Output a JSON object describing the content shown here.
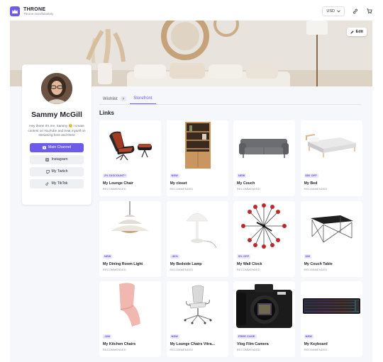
{
  "header": {
    "brand": "THRONE",
    "tagline": "Throne invisifulantely",
    "currency": "USD"
  },
  "banner": {
    "edit_label": "Edit"
  },
  "profile": {
    "name": "Sammy McGill",
    "bio": "Hey there! It's me, Sammy 😊 I create content on YouTube and treat myself on streaming here and there",
    "links": [
      {
        "label": "Main Channel",
        "icon": "play-icon"
      },
      {
        "label": "Instagram",
        "icon": "instagram-icon"
      },
      {
        "label": "My Twitch",
        "icon": "twitch-icon"
      },
      {
        "label": "My TikTok",
        "icon": "tiktok-icon"
      }
    ]
  },
  "tabs": [
    {
      "label": "Wishlist",
      "count": "7"
    },
    {
      "label": "Storefront"
    }
  ],
  "section_title": "Links",
  "products": [
    {
      "title": "My Lounge Chair",
      "badge": "2% DISCOUNT*",
      "sub": "RECOMMENDED"
    },
    {
      "title": "My closet",
      "badge": "NEW",
      "sub": "RECOMMENDED"
    },
    {
      "title": "My Couch",
      "badge": "NEW",
      "sub": "RECOMMENDED"
    },
    {
      "title": "My Bed",
      "badge": "$50 OFF",
      "sub": "RECOMMENDED"
    },
    {
      "title": "My Dining Room Light",
      "badge": "NEW",
      "sub": "RECOMMENDED"
    },
    {
      "title": "My Bedside Lamp",
      "badge": "-30%",
      "sub": "RECOMMENDED"
    },
    {
      "title": "My Wall Clock",
      "badge": "5% OFF",
      "sub": "RECOMMENDED"
    },
    {
      "title": "My Couch Table",
      "badge": "$30",
      "sub": "RECOMMENDED"
    },
    {
      "title": "My Kitchen Chairs",
      "badge": "-$30",
      "sub": "RECOMMENDED"
    },
    {
      "title": "My Lounge Chairs Vitra...",
      "badge": "NEW",
      "sub": "RECOMMENDED"
    },
    {
      "title": "Vlog Film Camera",
      "badge": "FREE CASE",
      "sub": "RECOMMENDED"
    },
    {
      "title": "My Keyboard",
      "badge": "NEW",
      "sub": "RECOMMENDED"
    }
  ],
  "colors": {
    "accent": "#6c5ce7",
    "background": "#f6f7fa"
  }
}
